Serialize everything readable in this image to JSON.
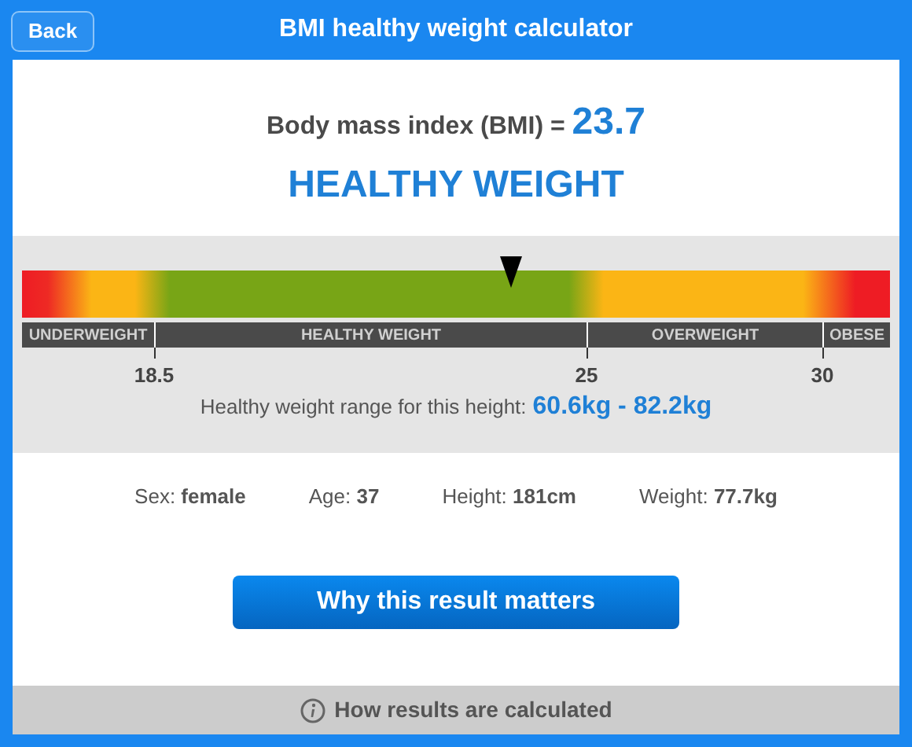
{
  "header": {
    "back_button": "Back",
    "title": "BMI healthy weight calculator"
  },
  "result": {
    "label": "Body mass index (BMI) =",
    "value": "23.7",
    "category": "HEALTHY WEIGHT"
  },
  "gauge": {
    "level": 0.563,
    "segments": [
      {
        "label": "UNDERWEIGHT"
      },
      {
        "label": "HEALTHY WEIGHT"
      },
      {
        "label": "OVERWEIGHT"
      },
      {
        "label": "OBESE"
      }
    ],
    "ticks": [
      "18.5",
      "25",
      "30"
    ],
    "range_label": "Healthy weight range for this height:",
    "range_value": "60.6kg - 82.2kg"
  },
  "details": [
    {
      "label": "Sex:",
      "value": "female"
    },
    {
      "label": "Age:",
      "value": "37"
    },
    {
      "label": "Height:",
      "value": "181cm"
    },
    {
      "label": "Weight:",
      "value": "77.7kg"
    }
  ],
  "action_button": "Why this result matters",
  "footer": {
    "link": "How results are calculated"
  }
}
